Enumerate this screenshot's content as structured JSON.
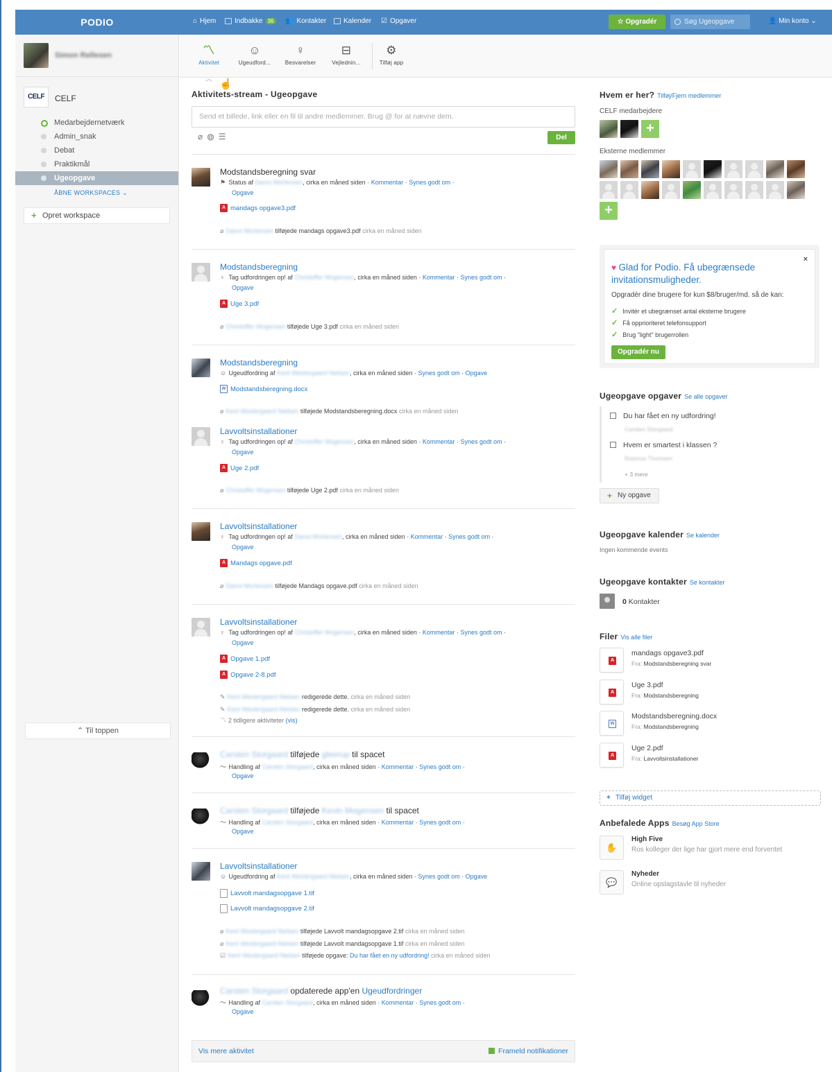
{
  "brand": "PODIO",
  "nav": {
    "home": "Hjem",
    "inbox": "Indbakke",
    "inbox_badge": "36",
    "contacts": "Kontakter",
    "calendar": "Kalender",
    "tasks": "Opgaver",
    "upgrade": "Opgradér",
    "search_placeholder": "Søg Ugeopgave",
    "account": "Min konto"
  },
  "sidebar": {
    "user_name": "Simon Rellesen",
    "org_logo": "CELF",
    "org_name": "CELF",
    "workspaces": [
      "Medarbejdernetværk",
      "Admin_snak",
      "Debat",
      "Praktikmål",
      "Ugeopgave"
    ],
    "open_workspaces": "ÅBNE WORKSPACES",
    "create_workspace": "Opret workspace",
    "to_top": "Til toppen"
  },
  "apps": [
    {
      "label": "Aktivitet",
      "icon": "activity-icon"
    },
    {
      "label": "Ugeudford...",
      "icon": "smiley-icon"
    },
    {
      "label": "Besvarelser",
      "icon": "lightbulb-icon"
    },
    {
      "label": "Vejlednin...",
      "icon": "inbox-icon"
    },
    {
      "label": "Tilføj app",
      "icon": "add-app-icon"
    }
  ],
  "stream": {
    "title": "Aktivitets-stream - Ugeopgave",
    "composer_placeholder": "Send et billede, link eller en fil til andre medlemmer. Brug @ for at nævne dem.",
    "share": "Del",
    "show_more": "Vis mere aktivitet",
    "unsubscribe": "Frameld notifikationer"
  },
  "common": {
    "ago": "cirka en måned siden",
    "comment": "Kommentar",
    "like": "Synes godt om",
    "task": "Opgave",
    "added": "tilføjede",
    "edited": "redigerede dette.",
    "of": "af"
  },
  "feed": {
    "e1": {
      "title": "Modstandsberegning svar",
      "type": "Status af",
      "who": "Danni Mortensen",
      "file": "mandags opgave3.pdf",
      "note_who": "Danni Mortensen",
      "note_file": "mandags opgave3.pdf"
    },
    "e2": {
      "title": "Modstandsberegning",
      "type": "Tag udfordringen op! af",
      "who": "Christoffer Mogensen",
      "file": "Uge 3.pdf",
      "note_who": "Christoffer Mogensen",
      "note_file": "Uge 3.pdf"
    },
    "e3": {
      "title": "Modstandsberegning",
      "type": "Ugeudfordring af",
      "who": "Kent Westergaard Nielsen",
      "file": "Modstandsberegning.docx",
      "note_who": "Kent Westergaard Nielsen",
      "note_file": "Modstandsberegning.docx"
    },
    "e4": {
      "title": "Lavvoltsinstallationer",
      "type": "Tag udfordringen op! af",
      "who": "Christoffer Mogensen",
      "file": "Uge 2.pdf",
      "note_who": "Christoffer Mogensen",
      "note_file": "Uge 2.pdf"
    },
    "e5": {
      "title": "Lavvoltsinstallationer",
      "type": "Tag udfordringen op! af",
      "who": "Danni Mortensen",
      "file": "Mandags opgave.pdf",
      "note_who": "Danni Mortensen",
      "note_file": "Mandags opgave.pdf"
    },
    "e6": {
      "title": "Lavvoltsinstallationer",
      "type": "Tag udfordringen op! af",
      "who": "Christoffer Mogensen",
      "file1": "Opgave 1.pdf",
      "file2": "Opgave 2-8.pdf",
      "edit_who": "Kent Westergaard Nielsen",
      "earlier": "2 tidligere aktiviteter",
      "view": "(vis)"
    },
    "e7": {
      "actor": "Carsten Storgaard",
      "verb": "tilføjede",
      "object": "gleerup",
      "suffix": "til spacet",
      "type": "Handling af",
      "who": "Carsten Storgaard"
    },
    "e8": {
      "actor": "Carsten Storgaard",
      "verb": "tilføjede",
      "object": "Kevin Mogensen",
      "suffix": "til spacet",
      "type": "Handling af",
      "who": "Carsten Storgaard"
    },
    "e9": {
      "title": "Lavvoltsinstallationer",
      "type": "Ugeudfordring af",
      "who": "Kent Westergaard Nielsen",
      "file1": "Lavvolt mandagsopgave 1.tif",
      "file2": "Lavvolt mandagsopgave 2.tif",
      "note_who": "Kent Westergaard Nielsen",
      "note3": "tilføjede opgave:",
      "note3_link": "Du har fået en ny udfordring!"
    },
    "e10": {
      "actor": "Carsten Storgaard",
      "verb": "opdaterede app'en",
      "object": "Ugeudfordringer",
      "type": "Handling af",
      "who": "Carsten Storgaard"
    }
  },
  "right": {
    "who_title": "Hvem er her?",
    "who_link": "Tilføj/Fjern medlemmer",
    "staff_label": "CELF medarbejdere",
    "external_label": "Eksterne medlemmer",
    "promo": {
      "title": "Glad for Podio. Få ubegrænsede invitationsmuligheder.",
      "desc": "Opgradér dine brugere for kun $8/bruger/md. så de kan:",
      "items": [
        "Invitér et ubegrænset antal eksterne brugere",
        "Få opprioriteret telefonsupport",
        "Brug \"light\" brugerrollen"
      ],
      "button": "Opgradér nu",
      "close": "×"
    },
    "tasks": {
      "title": "Ugeopgave opgaver",
      "link": "Se alle opgaver",
      "items": [
        {
          "label": "Du har fået en ny udfordring!",
          "sub": "Carsten Storgaard"
        },
        {
          "label": "Hvem er smartest i klassen ?",
          "sub": "Rasmus Thomsen"
        }
      ],
      "more": "+ 3 mere",
      "new": "Ny opgave"
    },
    "calendar": {
      "title": "Ugeopgave kalender",
      "link": "Se kalender",
      "empty": "Ingen kommende events"
    },
    "contacts": {
      "title": "Ugeopgave kontakter",
      "link": "Se kontakter",
      "count": "0",
      "label": "Kontakter"
    },
    "files": {
      "title": "Filer",
      "link": "Vis alle filer",
      "from": "Fra:",
      "items": [
        {
          "name": "mandags opgave3.pdf",
          "source": "Modstandsberegning svar"
        },
        {
          "name": "Uge 3.pdf",
          "source": "Modstandsberegning"
        },
        {
          "name": "Modstandsberegning.docx",
          "source": "Modstandsberegning"
        },
        {
          "name": "Uge 2.pdf",
          "source": "Lavvoltsinstallationer"
        }
      ]
    },
    "add_widget": "Tilføj widget",
    "rec_apps": {
      "title": "Anbefalede Apps",
      "link": "Besøg App Store",
      "items": [
        {
          "name": "High Five",
          "desc": "Ros kolleger der lige har gjort mere end forventet"
        },
        {
          "name": "Nyheder",
          "desc": "Online opslagstavle til nyheder"
        }
      ]
    }
  }
}
